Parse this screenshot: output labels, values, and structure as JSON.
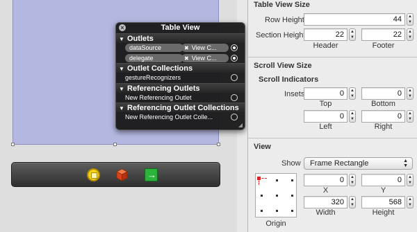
{
  "hud": {
    "title": "Table View",
    "sections": {
      "outlets": "Outlets",
      "outlet_collections": "Outlet Collections",
      "referencing_outlets": "Referencing Outlets",
      "referencing_outlet_collections": "Referencing Outlet Collections"
    },
    "outlets": [
      {
        "name": "dataSource",
        "target": "View C..."
      },
      {
        "name": "delegate",
        "target": "View C..."
      }
    ],
    "outlet_collections": [
      "gestureRecognizers"
    ],
    "new_referencing_outlet": "New Referencing Outlet",
    "new_referencing_outlet_collection": "New Referencing Outlet Colle..."
  },
  "inspector": {
    "table_view_size": {
      "title": "Table View Size",
      "row_height_label": "Row Height",
      "row_height": "44",
      "section_height_label": "Section Height",
      "header_value": "22",
      "footer_value": "22",
      "header_label": "Header",
      "footer_label": "Footer"
    },
    "scroll_view_size": {
      "title": "Scroll View Size",
      "indicators_title": "Scroll Indicators",
      "insets_label": "Insets",
      "top": "0",
      "bottom": "0",
      "left": "0",
      "right": "0",
      "top_label": "Top",
      "bottom_label": "Bottom",
      "left_label": "Left",
      "right_label": "Right"
    },
    "view": {
      "title": "View",
      "show_label": "Show",
      "show_value": "Frame Rectangle",
      "x": "0",
      "y": "0",
      "x_label": "X",
      "y_label": "Y",
      "width": "320",
      "height": "568",
      "width_label": "Width",
      "height_label": "Height",
      "origin_label": "Origin"
    }
  },
  "colors": {
    "table_view_fill": "#b4b7e0",
    "hud_background": "#161616",
    "dock_background": "#3a3a3a"
  }
}
